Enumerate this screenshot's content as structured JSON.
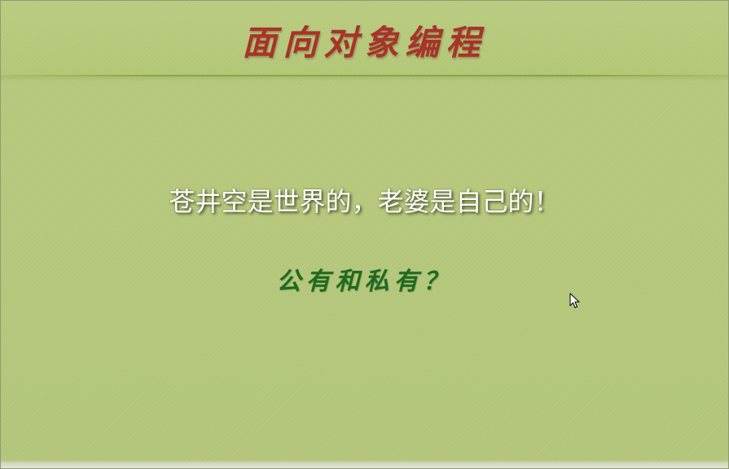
{
  "slide": {
    "title": "面向对象编程",
    "statement": "苍井空是世界的，老婆是自己的！",
    "question": "公有和私有？"
  },
  "colors": {
    "background": "#b6c97a",
    "title": "#a8332a",
    "statement": "#ffffff",
    "question": "#1f6a1f",
    "rule": "#8aa84a"
  },
  "icons": {
    "cursor": "arrow-cursor-icon"
  }
}
